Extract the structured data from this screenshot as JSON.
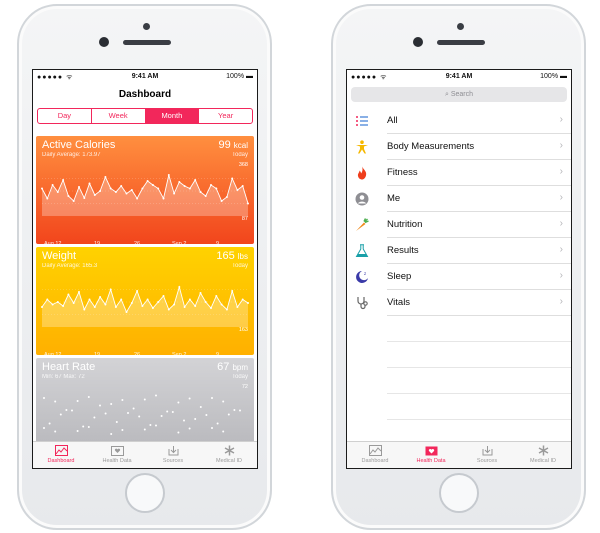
{
  "left_phone": {
    "status": {
      "carrier": "●●●●● ᯤ",
      "time": "9:41 AM",
      "battery": "100% ▬"
    },
    "title": "Dashboard",
    "segments": [
      {
        "label": "Day",
        "selected": false
      },
      {
        "label": "Week",
        "selected": false
      },
      {
        "label": "Month",
        "selected": true
      },
      {
        "label": "Year",
        "selected": false
      }
    ],
    "cards": [
      {
        "title": "Active Calories",
        "value": "99",
        "unit": "kcal",
        "subtitle": "Daily Average: 173.97",
        "right_sub": "Today",
        "max": "368",
        "min": "87",
        "axis": [
          "Aug 12",
          "19",
          "26",
          "Sep 2",
          "9"
        ],
        "color_top": "#ff8a3d",
        "color_bottom": "#f2481f",
        "series": [
          0.55,
          0.35,
          0.62,
          0.48,
          0.72,
          0.4,
          0.3,
          0.58,
          0.36,
          0.65,
          0.42,
          0.5,
          0.78,
          0.55,
          0.48,
          0.6,
          0.45,
          0.52,
          0.35,
          0.55,
          0.7,
          0.62,
          0.55,
          0.35,
          0.82,
          0.45,
          0.68,
          0.6,
          0.55,
          0.72,
          0.48,
          0.4,
          0.62,
          0.55,
          0.3,
          0.38,
          0.75,
          0.52,
          0.6,
          0.25
        ]
      },
      {
        "title": "Weight",
        "value": "165",
        "unit": "lbs",
        "subtitle": "Daily Average: 165.3",
        "right_sub": "Today",
        "max": "",
        "min": "163",
        "axis": [
          "Aug 12",
          "19",
          "26",
          "Sep 2",
          "9"
        ],
        "color_top": "#ffd100",
        "color_bottom": "#ffb300",
        "series": [
          0.4,
          0.55,
          0.45,
          0.5,
          0.42,
          0.65,
          0.48,
          0.7,
          0.35,
          0.55,
          0.4,
          0.6,
          0.45,
          0.75,
          0.4,
          0.55,
          0.3,
          0.48,
          0.72,
          0.42,
          0.55,
          0.38,
          0.5,
          0.62,
          0.35,
          0.45,
          0.8,
          0.4,
          0.55,
          0.42,
          0.68,
          0.5,
          0.38,
          0.62,
          0.45,
          0.35,
          0.72,
          0.4,
          0.55,
          0.48
        ]
      },
      {
        "title": "Heart Rate",
        "value": "67",
        "unit": "bpm",
        "subtitle": "Min: 67  Max: 72",
        "right_sub": "Today",
        "max": "72"
      }
    ],
    "tabs": [
      {
        "label": "Dashboard",
        "active": true
      },
      {
        "label": "Health Data",
        "active": false
      },
      {
        "label": "Sources",
        "active": false
      },
      {
        "label": "Medical ID",
        "active": false
      }
    ]
  },
  "right_phone": {
    "status": {
      "carrier": "●●●●● ᯤ",
      "time": "9:41 AM",
      "battery": "100% ▬"
    },
    "search_placeholder": "Search",
    "items": [
      {
        "label": "All",
        "icon": "list-icon"
      },
      {
        "label": "Body Measurements",
        "icon": "body-figure-icon"
      },
      {
        "label": "Fitness",
        "icon": "flame-icon"
      },
      {
        "label": "Me",
        "icon": "person-icon"
      },
      {
        "label": "Nutrition",
        "icon": "carrot-icon"
      },
      {
        "label": "Results",
        "icon": "flask-icon"
      },
      {
        "label": "Sleep",
        "icon": "moon-icon"
      },
      {
        "label": "Vitals",
        "icon": "stethoscope-icon"
      }
    ],
    "tabs": [
      {
        "label": "Dashboard",
        "active": false
      },
      {
        "label": "Health Data",
        "active": true
      },
      {
        "label": "Sources",
        "active": false
      },
      {
        "label": "Medical ID",
        "active": false
      }
    ]
  },
  "colors": {
    "accent": "#f2275b",
    "fitness_orange": "#f2481f",
    "weight_yellow": "#ffc400",
    "heart_gray": "#c9c9cc"
  }
}
